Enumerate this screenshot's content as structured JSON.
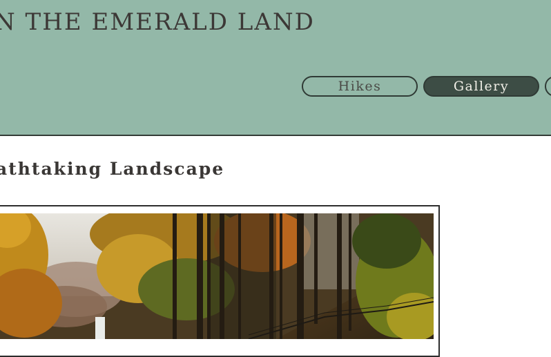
{
  "header": {
    "title": "N THE EMERALD LAND",
    "nav": [
      {
        "label": "Hikes",
        "active": false
      },
      {
        "label": "Gallery",
        "active": true
      },
      {
        "label": "",
        "active": false
      }
    ]
  },
  "main": {
    "section_title": "athtaking Landscape",
    "photo": {
      "subject": "autumn forest with waterfall"
    }
  },
  "colors": {
    "header_bg": "#93b8a8",
    "active_pill_bg": "#3d4d45",
    "text_dark": "#3c3836"
  }
}
